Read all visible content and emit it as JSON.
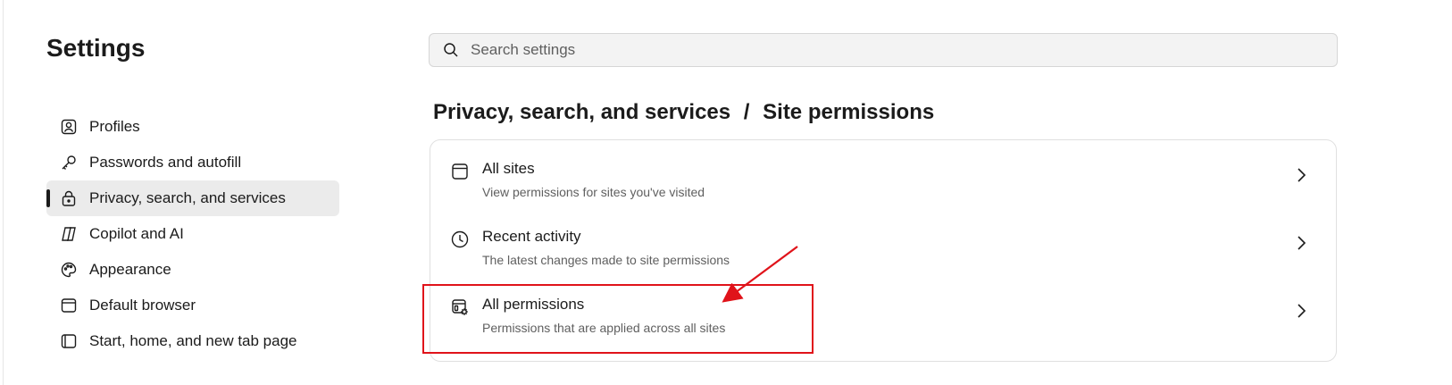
{
  "app_title": "Settings",
  "search": {
    "placeholder": "Search settings",
    "icon": "search-icon"
  },
  "sidebar": {
    "items": [
      {
        "label": "Profiles",
        "icon": "profile-icon",
        "active": false
      },
      {
        "label": "Passwords and autofill",
        "icon": "key-icon",
        "active": false
      },
      {
        "label": "Privacy, search, and services",
        "icon": "lock-icon",
        "active": true
      },
      {
        "label": "Copilot and AI",
        "icon": "copilot-icon",
        "active": false
      },
      {
        "label": "Appearance",
        "icon": "palette-icon",
        "active": false
      },
      {
        "label": "Default browser",
        "icon": "browser-icon",
        "active": false
      },
      {
        "label": "Start, home, and new tab page",
        "icon": "page-icon",
        "active": false
      }
    ]
  },
  "breadcrumb": {
    "parent": "Privacy, search, and services",
    "separator": "/",
    "current": "Site permissions"
  },
  "permissions": {
    "rows": [
      {
        "title": "All sites",
        "subtitle": "View permissions for sites you've visited",
        "icon": "window-icon"
      },
      {
        "title": "Recent activity",
        "subtitle": "The latest changes made to site permissions",
        "icon": "clock-icon"
      },
      {
        "title": "All permissions",
        "subtitle": "Permissions that are applied across all sites",
        "icon": "permissions-gear-icon"
      }
    ]
  },
  "annotation": {
    "color": "#e0131a",
    "target": "All permissions"
  }
}
